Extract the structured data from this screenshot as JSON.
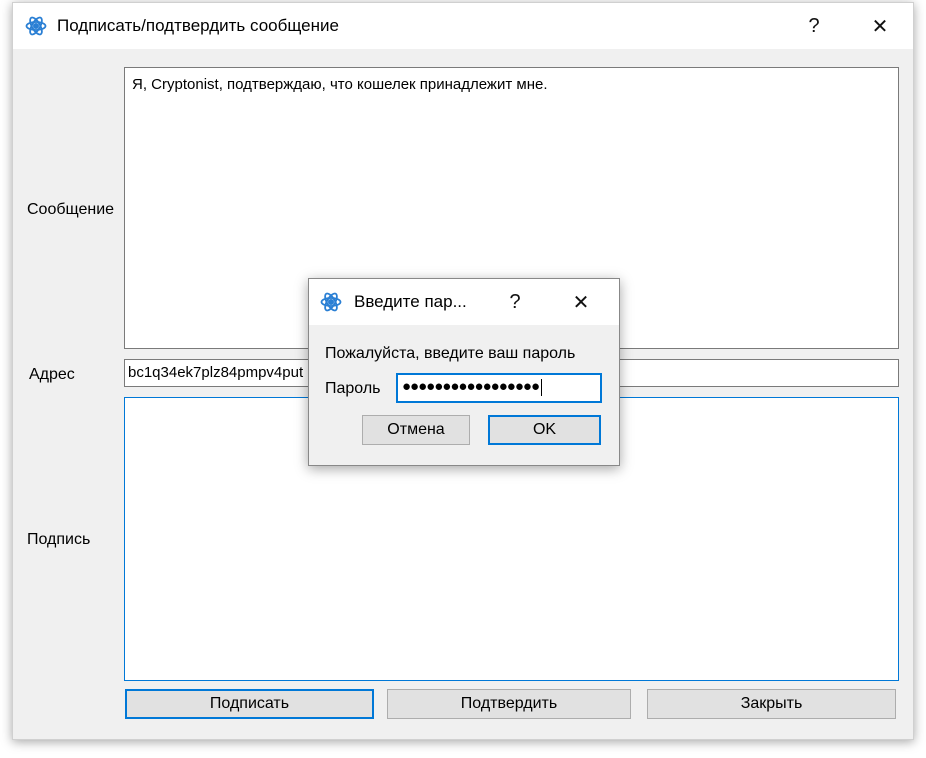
{
  "window": {
    "title": "Подписать/подтвердить сообщение",
    "help_label": "?",
    "close_label": "✕",
    "icon": "app-logo-icon"
  },
  "form": {
    "message_label": "Сообщение",
    "message_value": "Я, Cryptonist, подтверждаю, что кошелек принадлежит мне.",
    "address_label": "Адрес",
    "address_value": "bc1q34ek7plz84pmpv4put",
    "signature_label": "Подпись",
    "signature_value": ""
  },
  "buttons": {
    "sign": "Подписать",
    "verify": "Подтвердить",
    "close": "Закрыть"
  },
  "password_dialog": {
    "title": "Введите пар...",
    "help_label": "?",
    "close_label": "✕",
    "prompt": "Пожалуйста, введите ваш пароль",
    "password_label": "Пароль",
    "password_value": "●●●●●●●●●●●●●●●●●",
    "cancel": "Отмена",
    "ok": "OK"
  },
  "colors": {
    "accent": "#0078d7",
    "window_bg": "#f0f0f0",
    "button_bg": "#e1e1e1"
  }
}
